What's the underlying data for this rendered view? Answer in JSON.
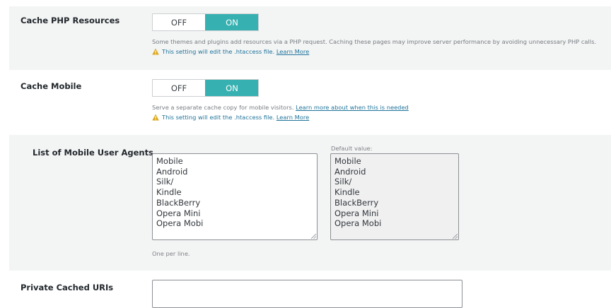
{
  "cache_php": {
    "label": "Cache PHP Resources",
    "off_label": "OFF",
    "on_label": "ON",
    "state": "ON",
    "description": "Some themes and plugins add resources via a PHP request. Caching these pages may improve server performance by avoiding unnecessary PHP calls.",
    "warning_text": "This setting will edit the .htaccess file.",
    "warning_link": "Learn More"
  },
  "cache_mobile": {
    "label": "Cache Mobile",
    "off_label": "OFF",
    "on_label": "ON",
    "state": "ON",
    "description": "Serve a separate cache copy for mobile visitors.",
    "description_link": "Learn more about when this is needed",
    "warning_text": "This setting will edit the .htaccess file.",
    "warning_link": "Learn More"
  },
  "mobile_agents": {
    "label": "List of Mobile User Agents",
    "value": "Mobile\nAndroid\nSilk/\nKindle\nBlackBerry\nOpera Mini\nOpera Mobi",
    "default_caption": "Default value:",
    "default_value": "Mobile\nAndroid\nSilk/\nKindle\nBlackBerry\nOpera Mini\nOpera Mobi",
    "hint": "One per line."
  },
  "private_uris": {
    "label": "Private Cached URIs",
    "value": ""
  },
  "colors": {
    "accent": "#36b0b0",
    "link": "#21759b",
    "warning": "#dba617",
    "row_shade": "#f3f4f4"
  }
}
